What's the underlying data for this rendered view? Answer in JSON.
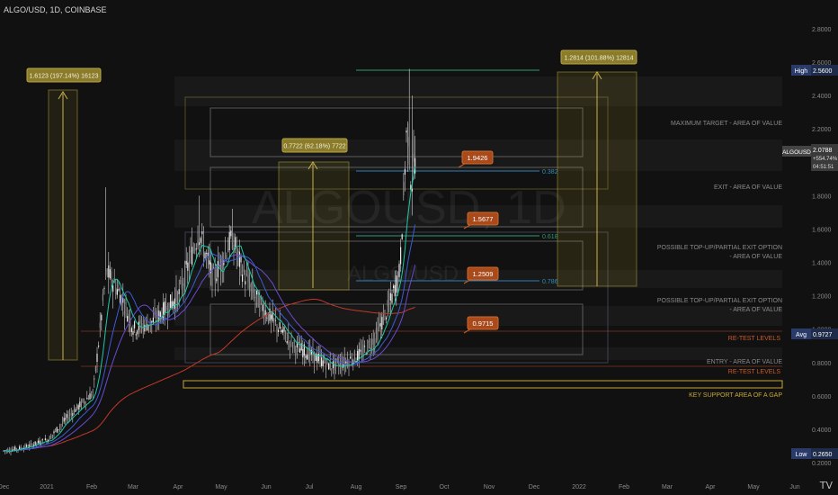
{
  "header": {
    "title": "ALGO/USD, 1D, COINBASE"
  },
  "watermark": {
    "main": "ALGOUSD, 1D",
    "sub": "ALGO/USD"
  },
  "logo": {
    "text": "TV"
  },
  "colors": {
    "background": "#111111",
    "up": "#26a69a",
    "down": "#ef5350",
    "candle": "#d9d9d9",
    "ema_fast": "#1ec8a8",
    "ema_mid": "#3d5bd8",
    "ema_slow": "#6a4bd0",
    "ma_long": "#c0392b",
    "target_box": "#b89d3c",
    "fib": "#2f8fb8",
    "label_orange": "#a84a1c",
    "label_gold": "#8b7c2a"
  },
  "chart_data": {
    "type": "candlestick",
    "symbol": "ALGOUSD",
    "exchange": "COINBASE",
    "timeframe": "1D",
    "x_ticks": [
      "Dec",
      "2021",
      "Feb",
      "Mar",
      "Apr",
      "May",
      "Jun",
      "Jul",
      "Aug",
      "Sep",
      "Oct",
      "Nov",
      "Dec",
      "2022",
      "Feb",
      "Mar",
      "Apr",
      "May",
      "Jun"
    ],
    "y_ticks": [
      "2.8000",
      "2.6000",
      "2.4000",
      "2.2000",
      "2.0000",
      "1.8000",
      "1.6000",
      "1.4000",
      "1.2000",
      "1.0000",
      "0.8000",
      "0.6000",
      "0.4000",
      "0.2000"
    ],
    "ylim": [
      0.2,
      2.8
    ],
    "price_series": [
      {
        "d": "2020-12-01",
        "c": 0.27
      },
      {
        "d": "2020-12-15",
        "c": 0.29
      },
      {
        "d": "2021-01-01",
        "c": 0.34
      },
      {
        "d": "2021-01-15",
        "c": 0.48
      },
      {
        "d": "2021-02-01",
        "c": 0.62
      },
      {
        "d": "2021-02-10",
        "c": 1.35
      },
      {
        "d": "2021-02-20",
        "c": 1.2
      },
      {
        "d": "2021-03-01",
        "c": 1.0
      },
      {
        "d": "2021-03-15",
        "c": 1.05
      },
      {
        "d": "2021-04-01",
        "c": 1.2
      },
      {
        "d": "2021-04-15",
        "c": 1.58
      },
      {
        "d": "2021-04-25",
        "c": 1.3
      },
      {
        "d": "2021-05-08",
        "c": 1.55
      },
      {
        "d": "2021-05-15",
        "c": 1.35
      },
      {
        "d": "2021-05-25",
        "c": 1.18
      },
      {
        "d": "2021-06-05",
        "c": 1.05
      },
      {
        "d": "2021-06-20",
        "c": 0.9
      },
      {
        "d": "2021-07-01",
        "c": 0.85
      },
      {
        "d": "2021-07-15",
        "c": 0.78
      },
      {
        "d": "2021-07-25",
        "c": 0.8
      },
      {
        "d": "2021-08-05",
        "c": 0.85
      },
      {
        "d": "2021-08-15",
        "c": 0.95
      },
      {
        "d": "2021-08-25",
        "c": 1.15
      },
      {
        "d": "2021-09-01",
        "c": 1.35
      },
      {
        "d": "2021-09-06",
        "c": 2.25
      },
      {
        "d": "2021-09-09",
        "c": 1.85
      },
      {
        "d": "2021-09-12",
        "c": 2.07
      }
    ],
    "levels": [
      {
        "value": 0.9715,
        "label": "0.9715"
      },
      {
        "value": 1.2509,
        "label": "1.2509"
      },
      {
        "value": 1.5677,
        "label": "1.5677"
      },
      {
        "value": 1.9426,
        "label": "1.9426"
      }
    ],
    "fib_levels": [
      {
        "ratio": "0.382",
        "label": "0.382"
      },
      {
        "ratio": "0.618",
        "label": "0.618"
      },
      {
        "ratio": "0.786",
        "label": "0.786"
      }
    ],
    "measure_labels": [
      "1.6123 (197.14%) 16123",
      "0.7722 (62.18%) 7722",
      "1.2814 (101.88%) 12814"
    ],
    "zone_labels": {
      "max_target": "MAXIMUM TARGET - AREA OF VALUE",
      "exit": "EXIT - AREA OF VALUE",
      "top_up_1_line1": "POSSIBLE TOP-UP/PARTIAL EXIT OPTION",
      "top_up_1_line2": "- AREA OF VALUE",
      "top_up_2_line1": "POSSIBLE TOP-UP/PARTIAL EXIT OPTION",
      "top_up_2_line2": "- AREA OF VALUE",
      "retest_1": "RE-TEST LEVELS",
      "entry": "ENTRY - AREA OF VALUE",
      "retest_2": "RE-TEST LEVELS",
      "key_support": "KEY SUPPORT AREA OF A GAP"
    },
    "price_tags": {
      "high": {
        "label": "High",
        "value": "2.5600"
      },
      "current": {
        "label": "ALGOUSD",
        "value": "2.0788",
        "change": "+554.74%",
        "countdown": "04:51:51"
      },
      "avg": {
        "label": "Avg",
        "value": "0.9727"
      },
      "low": {
        "label": "Low",
        "value": "0.2650"
      }
    }
  }
}
